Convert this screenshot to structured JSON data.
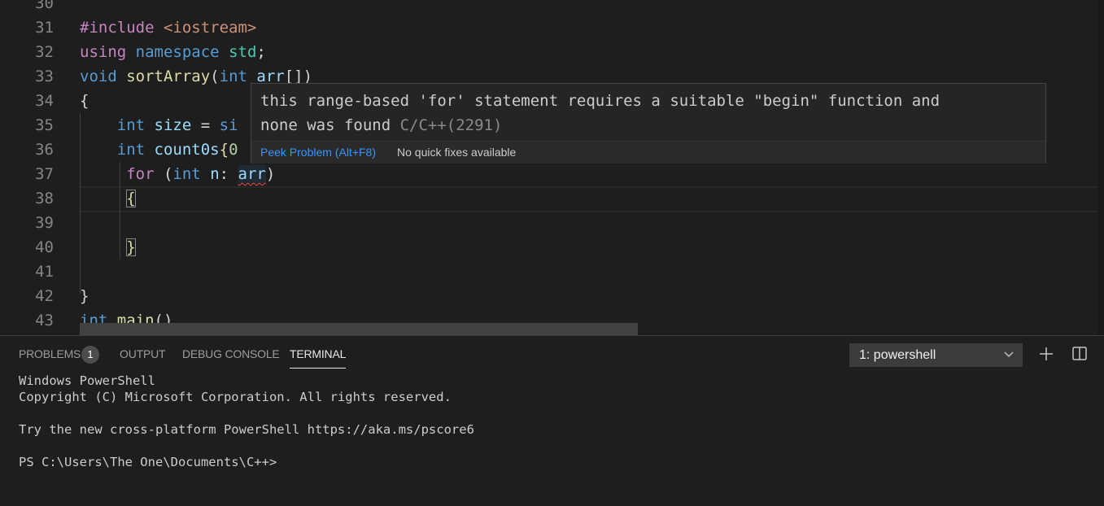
{
  "editor": {
    "lines": [
      {
        "num": "30",
        "tokens": []
      },
      {
        "num": "31",
        "tokens": [
          {
            "t": "#include",
            "c": "kw-ctrl"
          },
          {
            "t": " ",
            "c": "punc"
          },
          {
            "t": "<iostream>",
            "c": "str"
          }
        ]
      },
      {
        "num": "32",
        "tokens": [
          {
            "t": "using",
            "c": "kw-ctrl"
          },
          {
            "t": " ",
            "c": "punc"
          },
          {
            "t": "namespace",
            "c": "kw"
          },
          {
            "t": " ",
            "c": "punc"
          },
          {
            "t": "std",
            "c": "ns"
          },
          {
            "t": ";",
            "c": "punc"
          }
        ]
      },
      {
        "num": "33",
        "tokens": [
          {
            "t": "void",
            "c": "kw"
          },
          {
            "t": " ",
            "c": "punc"
          },
          {
            "t": "sortArray",
            "c": "fn"
          },
          {
            "t": "(",
            "c": "punc"
          },
          {
            "t": "int",
            "c": "kw"
          },
          {
            "t": " ",
            "c": "punc"
          },
          {
            "t": "arr",
            "c": "var"
          },
          {
            "t": "[])",
            "c": "punc"
          }
        ]
      },
      {
        "num": "34",
        "tokens": [
          {
            "t": "{",
            "c": "punc"
          }
        ]
      },
      {
        "num": "35",
        "tokens": [
          {
            "t": "    ",
            "c": "punc"
          },
          {
            "t": "int",
            "c": "kw"
          },
          {
            "t": " ",
            "c": "punc"
          },
          {
            "t": "size",
            "c": "var"
          },
          {
            "t": " = ",
            "c": "punc"
          },
          {
            "t": "si",
            "c": "kw"
          }
        ]
      },
      {
        "num": "36",
        "tokens": [
          {
            "t": "    ",
            "c": "punc"
          },
          {
            "t": "int",
            "c": "kw"
          },
          {
            "t": " ",
            "c": "punc"
          },
          {
            "t": "count0s",
            "c": "var"
          },
          {
            "t": "{",
            "c": "brace"
          },
          {
            "t": "0",
            "c": "num"
          }
        ]
      },
      {
        "num": "37",
        "tokens": [
          {
            "t": "     ",
            "c": "punc"
          },
          {
            "t": "for",
            "c": "kw-ctrl"
          },
          {
            "t": " (",
            "c": "punc"
          },
          {
            "t": "int",
            "c": "kw"
          },
          {
            "t": " ",
            "c": "punc"
          },
          {
            "t": "n",
            "c": "var"
          },
          {
            "t": ": ",
            "c": "punc"
          },
          {
            "t": "arr",
            "c": "var squiggle"
          },
          {
            "t": ")",
            "c": "punc"
          }
        ]
      },
      {
        "num": "38",
        "tokens": [
          {
            "t": "     ",
            "c": "punc"
          },
          {
            "t": "{",
            "c": "brace bracket-match"
          }
        ]
      },
      {
        "num": "39",
        "tokens": []
      },
      {
        "num": "40",
        "tokens": [
          {
            "t": "     ",
            "c": "punc"
          },
          {
            "t": "}",
            "c": "brace bracket-match"
          }
        ]
      },
      {
        "num": "41",
        "tokens": []
      },
      {
        "num": "42",
        "tokens": [
          {
            "t": "}",
            "c": "punc"
          }
        ]
      },
      {
        "num": "43",
        "tokens": [
          {
            "t": "int",
            "c": "kw"
          },
          {
            "t": " ",
            "c": "punc"
          },
          {
            "t": "main",
            "c": "fn"
          },
          {
            "t": "()",
            "c": "punc"
          }
        ]
      }
    ]
  },
  "hover": {
    "message_line1": "this range-based 'for' statement requires a suitable \"begin\" function and",
    "message_line2": "none was found",
    "code": "C/C++(2291)",
    "peek_label": "Peek Problem (Alt+F8)",
    "no_fix_label": "No quick fixes available"
  },
  "panel": {
    "tabs": [
      {
        "label": "PROBLEMS",
        "active": false
      },
      {
        "label": "OUTPUT",
        "active": false
      },
      {
        "label": "DEBUG CONSOLE",
        "active": false
      },
      {
        "label": "TERMINAL",
        "active": true
      }
    ],
    "problems_count": "1",
    "terminal_select": "1: powershell",
    "terminal_lines": [
      "Windows PowerShell",
      "Copyright (C) Microsoft Corporation. All rights reserved.",
      "",
      "Try the new cross-platform PowerShell https://aka.ms/pscore6",
      "",
      "PS C:\\Users\\The One\\Documents\\C++>"
    ]
  }
}
